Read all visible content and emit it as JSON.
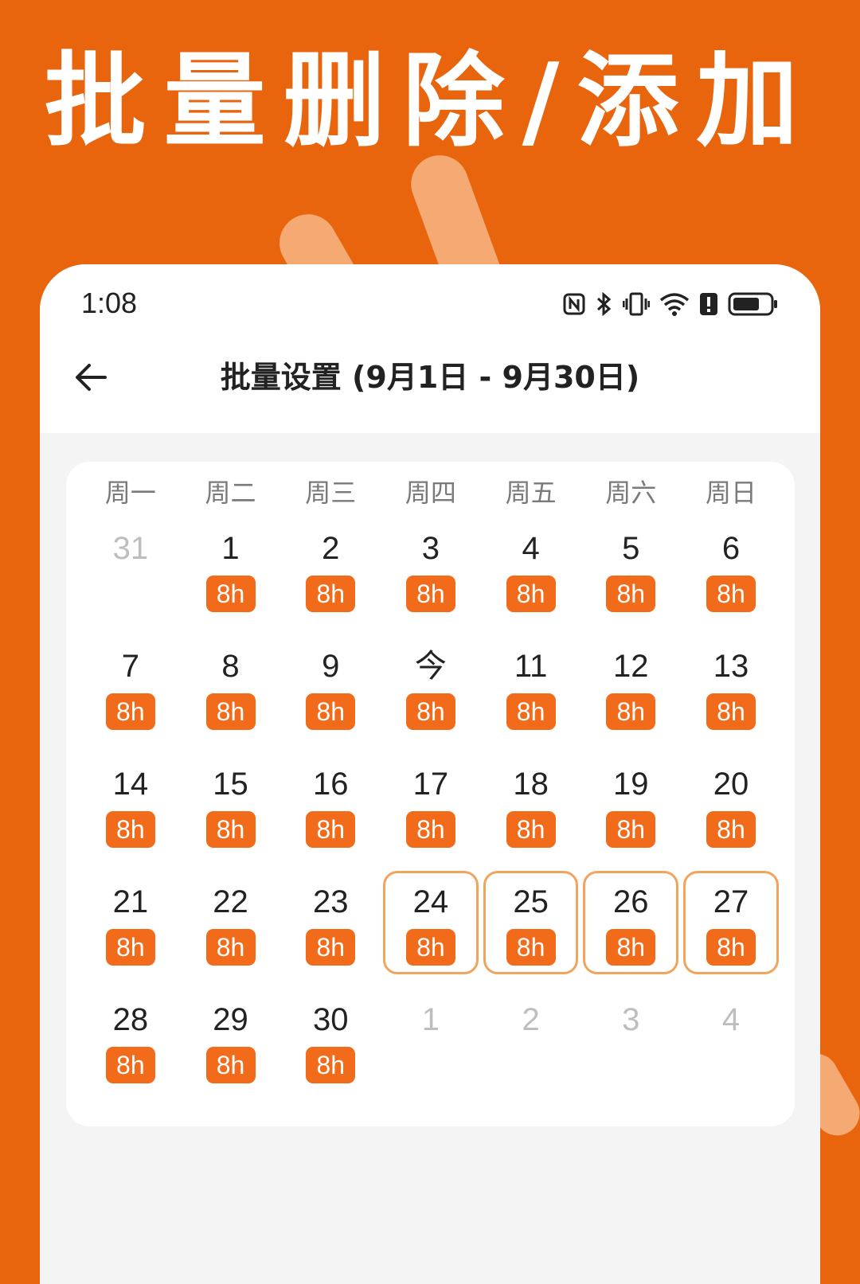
{
  "headline": "批量删除/添加",
  "status_bar": {
    "time": "1:08",
    "icons": [
      "nfc-icon",
      "bluetooth-icon",
      "vibrate-icon",
      "wifi-icon",
      "alert-icon",
      "battery-icon"
    ]
  },
  "header": {
    "title": "批量设置 (9月1日 - 9月30日)"
  },
  "weekdays": [
    "周一",
    "周二",
    "周三",
    "周四",
    "周五",
    "周六",
    "周日"
  ],
  "days": [
    {
      "label": "31",
      "muted": true
    },
    {
      "label": "1",
      "hours": "8h"
    },
    {
      "label": "2",
      "hours": "8h"
    },
    {
      "label": "3",
      "hours": "8h"
    },
    {
      "label": "4",
      "hours": "8h"
    },
    {
      "label": "5",
      "hours": "8h"
    },
    {
      "label": "6",
      "hours": "8h"
    },
    {
      "label": "7",
      "hours": "8h"
    },
    {
      "label": "8",
      "hours": "8h"
    },
    {
      "label": "9",
      "hours": "8h"
    },
    {
      "label": "今",
      "hours": "8h"
    },
    {
      "label": "11",
      "hours": "8h"
    },
    {
      "label": "12",
      "hours": "8h"
    },
    {
      "label": "13",
      "hours": "8h"
    },
    {
      "label": "14",
      "hours": "8h"
    },
    {
      "label": "15",
      "hours": "8h"
    },
    {
      "label": "16",
      "hours": "8h"
    },
    {
      "label": "17",
      "hours": "8h"
    },
    {
      "label": "18",
      "hours": "8h"
    },
    {
      "label": "19",
      "hours": "8h"
    },
    {
      "label": "20",
      "hours": "8h"
    },
    {
      "label": "21",
      "hours": "8h"
    },
    {
      "label": "22",
      "hours": "8h"
    },
    {
      "label": "23",
      "hours": "8h"
    },
    {
      "label": "24",
      "hours": "8h",
      "selected": true
    },
    {
      "label": "25",
      "hours": "8h",
      "selected": true
    },
    {
      "label": "26",
      "hours": "8h",
      "selected": true
    },
    {
      "label": "27",
      "hours": "8h",
      "selected": true
    },
    {
      "label": "28",
      "hours": "8h"
    },
    {
      "label": "29",
      "hours": "8h"
    },
    {
      "label": "30",
      "hours": "8h"
    },
    {
      "label": "1",
      "muted": true
    },
    {
      "label": "2",
      "muted": true
    },
    {
      "label": "3",
      "muted": true
    },
    {
      "label": "4",
      "muted": true
    }
  ],
  "colors": {
    "brand_orange": "#E8650D",
    "badge_orange": "#F26B1A",
    "selected_border": "#F2A35C"
  }
}
